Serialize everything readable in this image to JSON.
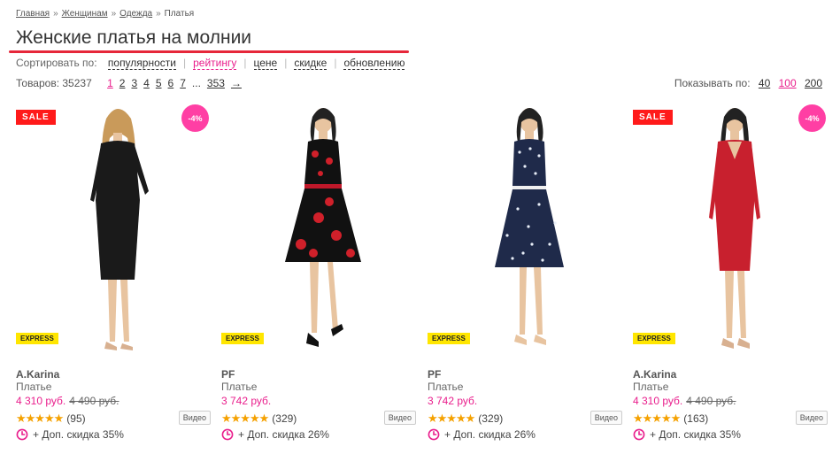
{
  "breadcrumb": {
    "items": [
      "Главная",
      "Женщинам",
      "Одежда",
      "Платья"
    ],
    "separator": "»"
  },
  "title": "Женские платья на молнии",
  "sort": {
    "label": "Сортировать по:",
    "options": [
      "популярности",
      "рейтингу",
      "цене",
      "скидке",
      "обновлению"
    ],
    "active_index": 1
  },
  "count": {
    "label": "Товаров: 35237",
    "pages": [
      "1",
      "2",
      "3",
      "4",
      "5",
      "6",
      "7"
    ],
    "ellipsis": "...",
    "last_page": "353",
    "next_arrow": "→"
  },
  "show": {
    "label": "Показывать по:",
    "options": [
      "40",
      "100",
      "200"
    ],
    "active_index": 1
  },
  "colors": {
    "accent": "#e91e8c",
    "title_underline": "#e6273a",
    "sale_badge": "#ff1a1a",
    "discount_badge": "#ff3fa4",
    "express_badge": "#ffe600",
    "stars": "#f5a100"
  },
  "products": [
    {
      "sale": "SALE",
      "discount": "-4%",
      "express": "EXPRESS",
      "brand": "A.Karina",
      "type": "Платье",
      "price": "4 310 руб.",
      "old_price": "4 490 руб.",
      "stars": "★★★★★",
      "reviews": "(95)",
      "video": "Видео",
      "promo": "+ Доп. скидка 35%",
      "dress": "black",
      "rating": 5
    },
    {
      "sale": "",
      "discount": "",
      "express": "EXPRESS",
      "brand": "PF",
      "type": "Платье",
      "price": "3 742 руб.",
      "old_price": "",
      "stars": "★★★★★",
      "reviews": "(329)",
      "video": "Видео",
      "promo": "+ Доп. скидка 26%",
      "dress": "floral",
      "rating": 5
    },
    {
      "sale": "",
      "discount": "",
      "express": "EXPRESS",
      "brand": "PF",
      "type": "Платье",
      "price": "3 742 руб.",
      "old_price": "",
      "stars": "★★★★★",
      "reviews": "(329)",
      "video": "Видео",
      "promo": "+ Доп. скидка 26%",
      "dress": "polka-dot",
      "rating": 5
    },
    {
      "sale": "SALE",
      "discount": "-4%",
      "express": "EXPRESS",
      "brand": "A.Karina",
      "type": "Платье",
      "price": "4 310 руб.",
      "old_price": "4 490 руб.",
      "stars": "★★★★★",
      "reviews": "(163)",
      "video": "Видео",
      "promo": "+ Доп. скидка 35%",
      "dress": "red",
      "rating": 5
    }
  ]
}
